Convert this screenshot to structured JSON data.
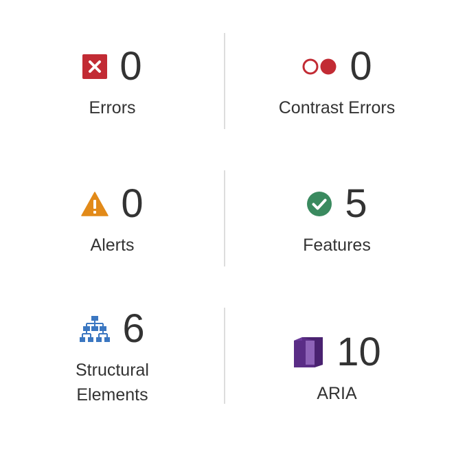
{
  "colors": {
    "error": "#c22b34",
    "alert": "#e28a19",
    "feature": "#3a8a5f",
    "structure": "#3b77c1",
    "aria": "#5a2d86",
    "text": "#333333",
    "divider": "#dddddd"
  },
  "summary": {
    "errors": {
      "icon": "error-x-icon",
      "count": "0",
      "label": "Errors"
    },
    "contrast_errors": {
      "icon": "contrast-circles-icon",
      "count": "0",
      "label": "Contrast Errors"
    },
    "alerts": {
      "icon": "alert-triangle-icon",
      "count": "0",
      "label": "Alerts"
    },
    "features": {
      "icon": "check-circle-icon",
      "count": "5",
      "label": "Features"
    },
    "structural_elements": {
      "icon": "hierarchy-icon",
      "count": "6",
      "label_line1": "Structural",
      "label_line2": "Elements"
    },
    "aria": {
      "icon": "aria-cube-icon",
      "count": "10",
      "label": "ARIA"
    }
  }
}
